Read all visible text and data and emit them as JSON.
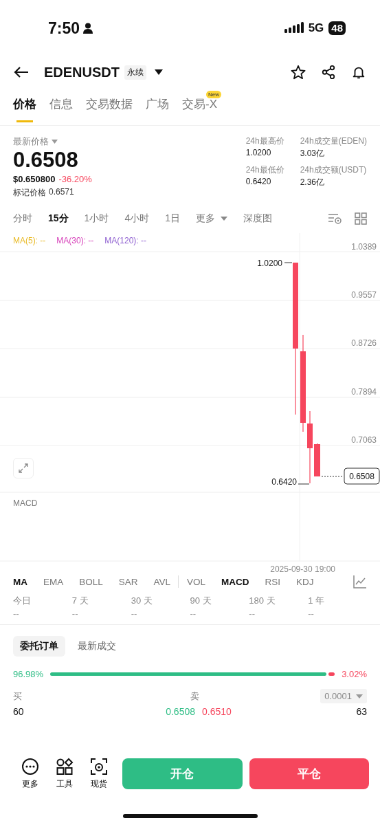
{
  "status_bar": {
    "time": "7:50",
    "network": "5G",
    "battery": "48"
  },
  "header": {
    "symbol": "EDENUSDT",
    "contract_tag": "永续"
  },
  "tabs": [
    {
      "label": "价格",
      "selected": true
    },
    {
      "label": "信息",
      "selected": false
    },
    {
      "label": "交易数据",
      "selected": false
    },
    {
      "label": "广场",
      "selected": false
    },
    {
      "label": "交易-X",
      "selected": false,
      "badge": "New"
    }
  ],
  "price": {
    "label": "最新价格",
    "last": "0.6508",
    "usd": "$0.650800",
    "change": "-36.20%",
    "mark_label": "标记价格",
    "mark": "0.6571"
  },
  "stats": [
    {
      "label": "24h最高价",
      "value": "1.0200"
    },
    {
      "label": "24h成交量(EDEN)",
      "value": "3.03亿"
    },
    {
      "label": "24h最低价",
      "value": "0.6420"
    },
    {
      "label": "24h成交额(USDT)",
      "value": "2.36亿"
    }
  ],
  "intervals": [
    {
      "label": "分时",
      "selected": false
    },
    {
      "label": "15分",
      "selected": true
    },
    {
      "label": "1小时",
      "selected": false
    },
    {
      "label": "4小时",
      "selected": false
    },
    {
      "label": "1日",
      "selected": false
    },
    {
      "label": "更多",
      "selected": false,
      "kind": "dropdown"
    },
    {
      "label": "深度图",
      "selected": false
    }
  ],
  "ma_legend": [
    {
      "label": "MA(5): --",
      "color": "#e8b923"
    },
    {
      "label": "MA(30): --",
      "color": "#d63fb9"
    },
    {
      "label": "MA(120): --",
      "color": "#8e5fd0"
    }
  ],
  "chart": {
    "y_labels": [
      "1.0389",
      "0.9557",
      "0.8726",
      "0.7894",
      "0.7063"
    ],
    "high_marker": "1.0200",
    "low_marker": "0.6420",
    "price_tag": "0.6508",
    "sub_title": "MACD",
    "time_label": "2025-09-30 19:00"
  },
  "indicators": [
    {
      "label": "MA",
      "selected": true
    },
    {
      "label": "EMA",
      "selected": false
    },
    {
      "label": "BOLL",
      "selected": false
    },
    {
      "label": "SAR",
      "selected": false
    },
    {
      "label": "AVL",
      "selected": false
    },
    {
      "label": "VOL",
      "selected": false
    },
    {
      "label": "MACD",
      "selected": true
    },
    {
      "label": "RSI",
      "selected": false
    },
    {
      "label": "KDJ",
      "selected": false
    }
  ],
  "periods": [
    {
      "label": "今日",
      "value": "--"
    },
    {
      "label": "7 天",
      "value": "--"
    },
    {
      "label": "30 天",
      "value": "--"
    },
    {
      "label": "90 天",
      "value": "--"
    },
    {
      "label": "180 天",
      "value": "--"
    },
    {
      "label": "1 年",
      "value": "--"
    }
  ],
  "order_tabs": [
    {
      "label": "委托订单",
      "selected": true
    },
    {
      "label": "最新成交",
      "selected": false
    }
  ],
  "ratio": {
    "buy": "96.98%",
    "sell": "3.02%"
  },
  "book_header": {
    "buy": "买",
    "sell": "卖",
    "precision": "0.0001"
  },
  "book_rows": [
    {
      "bid_qty": "60",
      "bid": "0.6508",
      "ask": "0.6510",
      "ask_qty": "63"
    }
  ],
  "bottom_bar": {
    "tools": [
      {
        "label": "更多",
        "kind": "more"
      },
      {
        "label": "工具",
        "kind": "tools"
      },
      {
        "label": "现货",
        "kind": "spot"
      }
    ],
    "open": "开仓",
    "close": "平仓"
  }
}
